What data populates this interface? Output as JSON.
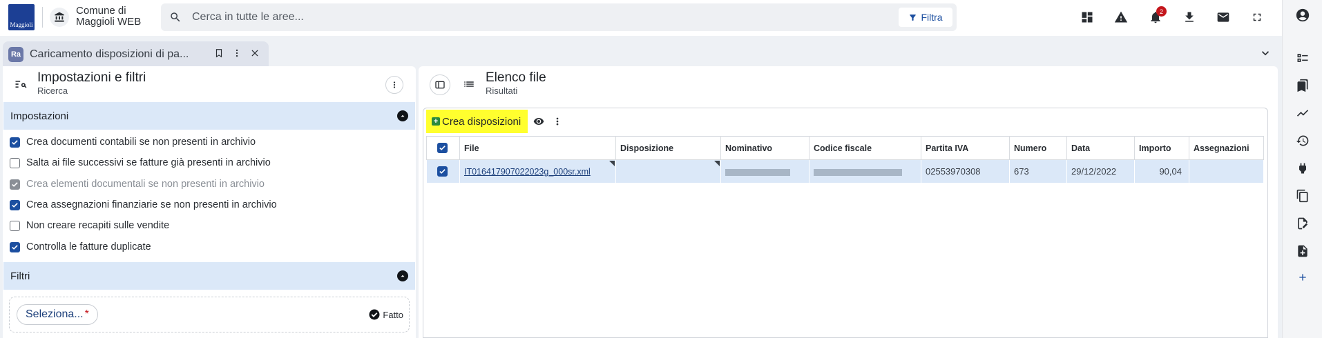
{
  "header": {
    "logo_text": "Maggioli",
    "municipality": "Comune di Maggioli WEB",
    "search_placeholder": "Cerca in tutte le aree...",
    "filter_label": "Filtra",
    "notifications_count": "2"
  },
  "tab": {
    "avatar": "Ra",
    "title": "Caricamento disposizioni di pa..."
  },
  "left": {
    "title": "Impostazioni e filtri",
    "subtitle": "Ricerca",
    "settings_section": "Impostazioni",
    "options": [
      {
        "label": "Crea documenti contabili se non presenti in archivio",
        "checked": true,
        "disabled": false
      },
      {
        "label": "Salta ai file successivi se fatture già presenti in archivio",
        "checked": false,
        "disabled": false
      },
      {
        "label": "Crea elementi documentali se non presenti in archivio",
        "checked": true,
        "disabled": true
      },
      {
        "label": "Crea assegnazioni finanziarie se non presenti in archivio",
        "checked": true,
        "disabled": false
      },
      {
        "label": "Non creare recapiti sulle vendite",
        "checked": false,
        "disabled": false
      },
      {
        "label": "Controlla le fatture duplicate",
        "checked": true,
        "disabled": false
      }
    ],
    "filters_section": "Filtri",
    "select_chip": "Seleziona...",
    "required_mark": "*",
    "done_label": "Fatto"
  },
  "right": {
    "title": "Elenco file",
    "subtitle": "Risultati",
    "create_button": "Crea disposizioni",
    "columns": [
      "File",
      "Disposizione",
      "Nominativo",
      "Codice fiscale",
      "Partita IVA",
      "Numero",
      "Data",
      "Importo",
      "Assegnazioni"
    ],
    "rows": [
      {
        "file": "IT016417907022023g_000sr.xml",
        "disposizione": "",
        "nominativo": "",
        "codice_fiscale": "",
        "partita_iva": "02553970308",
        "numero": "673",
        "data": "29/12/2022",
        "importo": "90,04",
        "assegnazioni": ""
      }
    ]
  },
  "colors": {
    "accent": "#1c4fa0",
    "highlight": "#ffff2e",
    "selected_row": "#dbe8f8"
  }
}
